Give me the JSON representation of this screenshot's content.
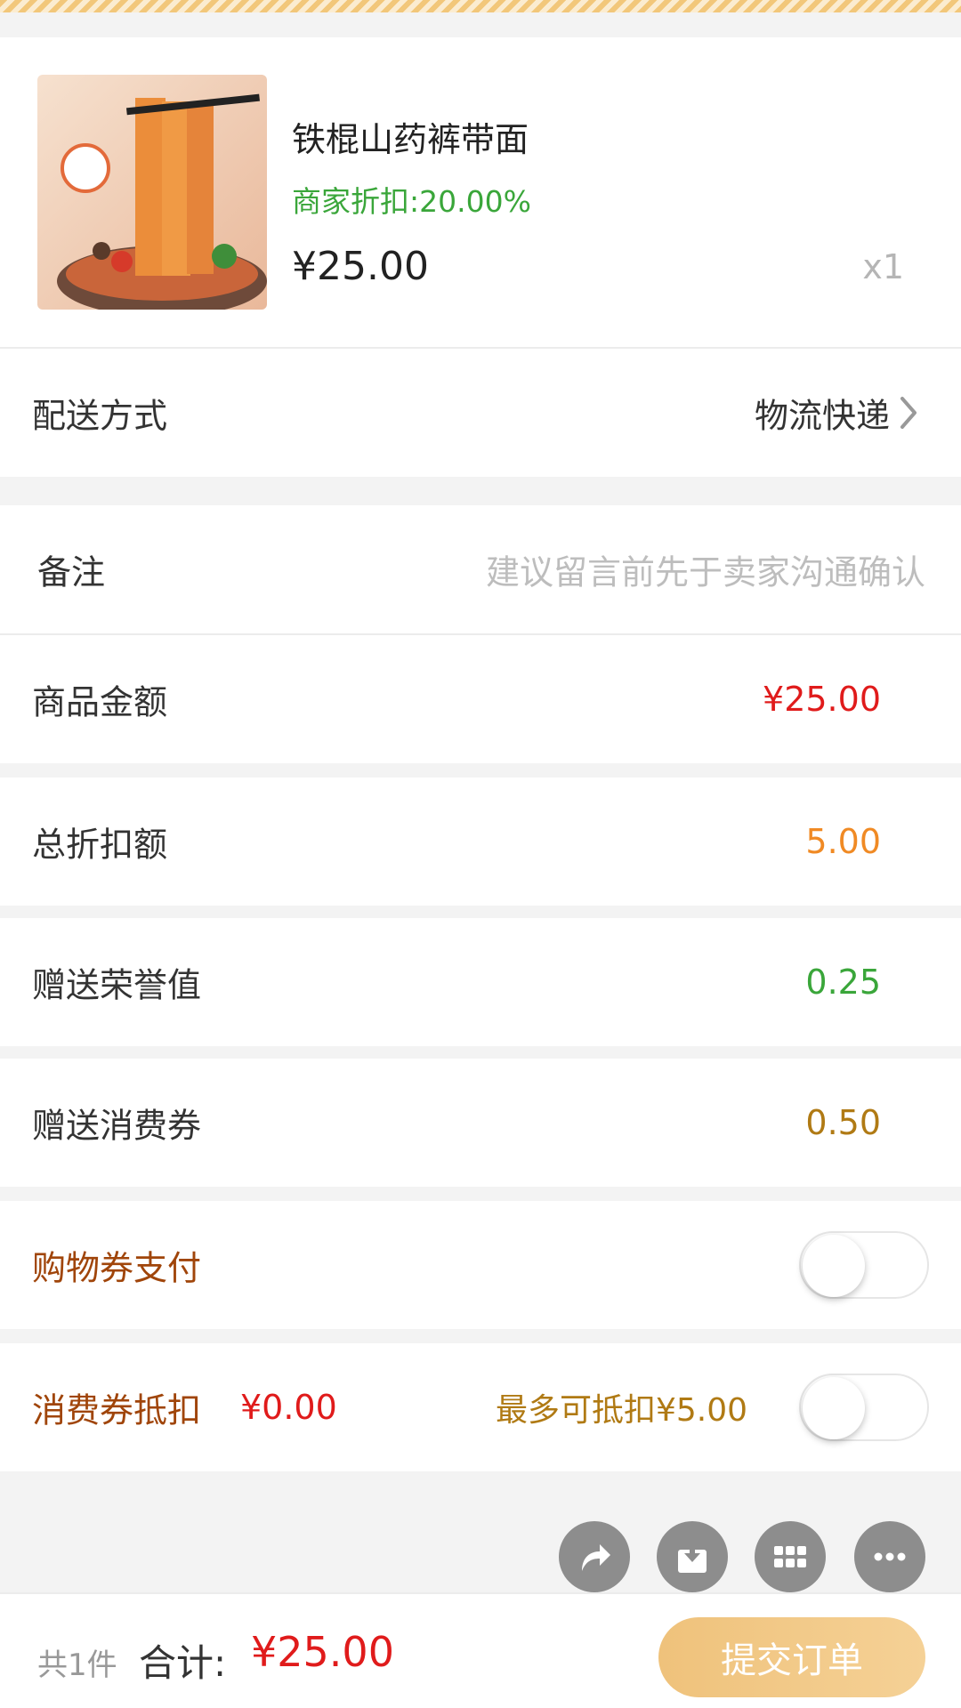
{
  "product": {
    "title": "铁棍山药裤带面",
    "discount": "商家折扣:20.00%",
    "price": "¥25.00",
    "quantity": "x1"
  },
  "delivery": {
    "label": "配送方式",
    "value": "物流快递"
  },
  "remark": {
    "label": "备注",
    "placeholder": "建议留言前先于卖家沟通确认"
  },
  "summary": {
    "goods_amount_label": "商品金额",
    "goods_amount_value": "¥25.00",
    "total_discount_label": "总折扣额",
    "total_discount_value": "5.00",
    "honor_label": "赠送荣誉值",
    "honor_value": "0.25",
    "voucher_gift_label": "赠送消费券",
    "voucher_gift_value": "0.50"
  },
  "shopping_voucher": {
    "label": "购物券支付",
    "enabled": false
  },
  "consume_voucher": {
    "label": "消费券抵扣",
    "amount": "¥0.00",
    "max_hint": "最多可抵扣¥5.00",
    "enabled": false
  },
  "fab_icons": [
    "share-icon",
    "download-icon",
    "grid-icon",
    "more-icon"
  ],
  "footer": {
    "count": "共1件",
    "total_label": "合计:",
    "total_value": "¥25.00",
    "submit_label": "提交订单"
  },
  "colors": {
    "accent_red": "#e01b1b",
    "orange": "#f08a24",
    "green": "#3aa63a",
    "gold": "#b07a14",
    "brown": "#a0450a",
    "button_gold": "#efc27b"
  }
}
